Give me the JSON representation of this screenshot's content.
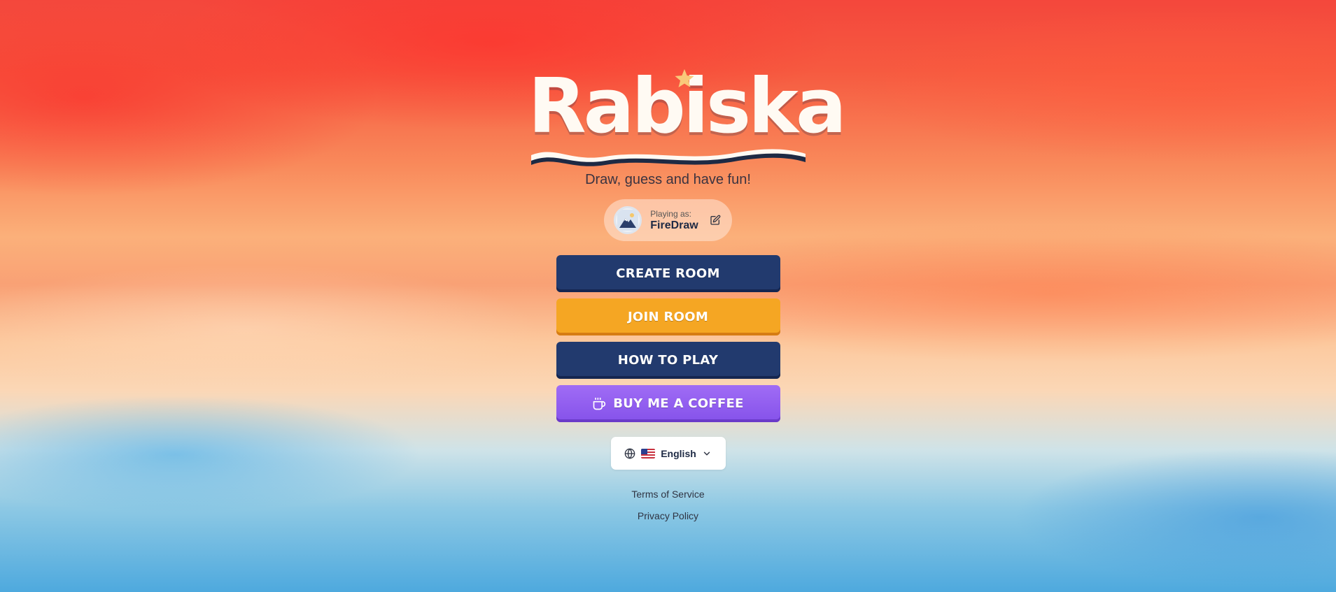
{
  "app": {
    "logo_text": "Rabiska",
    "tagline": "Draw, guess and have fun!"
  },
  "player": {
    "label": "Playing as:",
    "name": "FireDraw"
  },
  "menu": {
    "create_room": "CREATE ROOM",
    "join_room": "JOIN ROOM",
    "how_to_play": "HOW TO PLAY",
    "buy_coffee": "BUY ME A COFFEE"
  },
  "language": {
    "selected": "English"
  },
  "footer": {
    "terms": "Terms of Service",
    "privacy": "Privacy Policy"
  },
  "colors": {
    "navy": "#223a6e",
    "orange": "#f5a623",
    "purple": "#8552ea",
    "logo": "#fffaf3"
  },
  "icons": [
    "star-icon",
    "avatar-mountain-icon",
    "edit-icon",
    "coffee-cup-icon",
    "globe-icon",
    "us-flag-icon",
    "chevron-down-icon"
  ]
}
